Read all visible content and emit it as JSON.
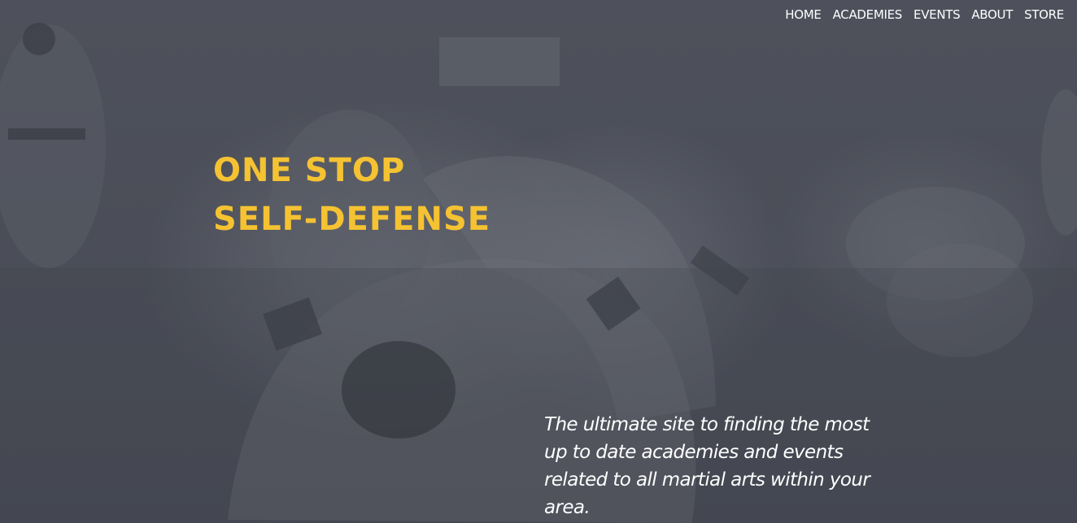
{
  "nav": {
    "items": [
      {
        "label": "HOME"
      },
      {
        "label": "ACADEMIES"
      },
      {
        "label": "EVENTS"
      },
      {
        "label": "ABOUT"
      },
      {
        "label": "STORE"
      }
    ]
  },
  "hero": {
    "headline_line1": "ONE STOP",
    "headline_line2": "SELF-DEFENSE",
    "tagline": "The ultimate site to finding the most up to date academies and events related to all martial arts within your area."
  },
  "colors": {
    "accent": "#f5c232",
    "overlay": "#4a4d57",
    "text": "#ffffff"
  }
}
